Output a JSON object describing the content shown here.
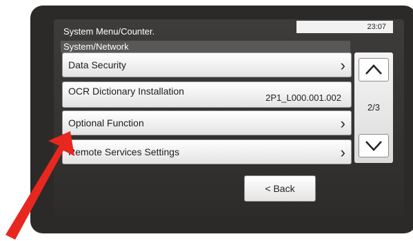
{
  "header": {
    "title": "System Menu/Counter.",
    "clock": "23:07",
    "breadcrumb": "System/Network"
  },
  "menu": {
    "items": [
      {
        "label": "Data Security",
        "value": ""
      },
      {
        "label": "OCR Dictionary Installation",
        "value": "2P1_L000.001.002"
      },
      {
        "label": "Optional Function",
        "value": ""
      },
      {
        "label": "Remote Services Settings",
        "value": ""
      }
    ]
  },
  "pager": {
    "page": "2/3",
    "up_icon": "chevron-up-icon",
    "down_icon": "chevron-down-icon"
  },
  "footer": {
    "back_label": "< Back"
  },
  "annotation": {
    "arrow_color": "#e8271f",
    "arrow_target": "Optional Function"
  },
  "colors": {
    "bezel": "#2c2a28",
    "screen": "#3a3836",
    "row": "#f0f0f0"
  }
}
